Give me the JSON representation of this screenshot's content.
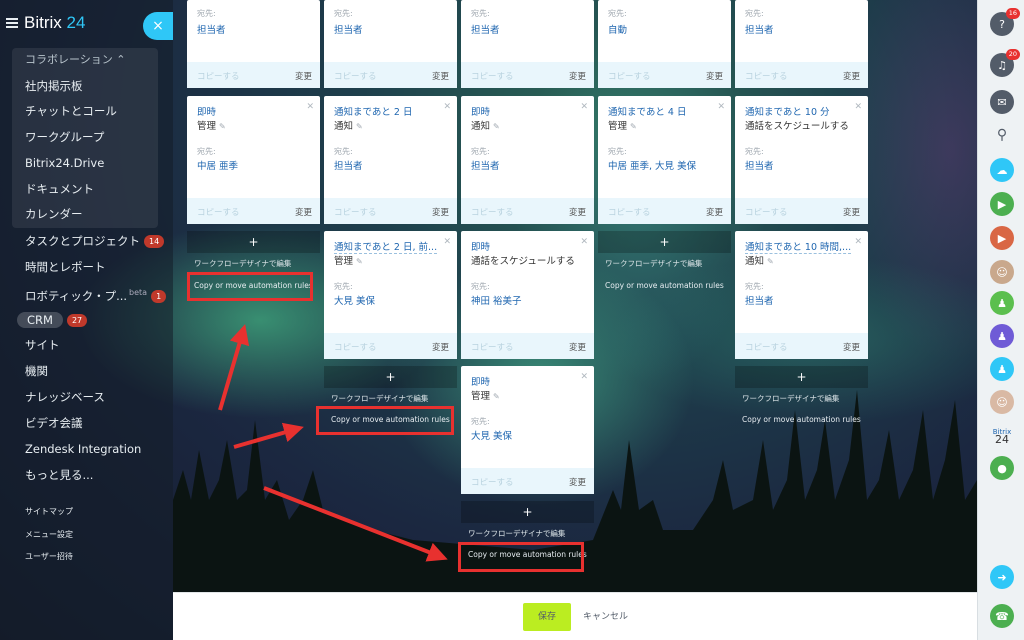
{
  "sidebar": {
    "logo_text": "Bitrix",
    "logo_num": "24",
    "close_symbol": "×",
    "section_label": "コラボレーション ⌃",
    "collab_items": [
      "社内掲示板",
      "チャットとコール",
      "ワークグループ",
      "Bitrix24.Drive",
      "ドキュメント",
      "カレンダー"
    ],
    "tasks_label": "タスクとプロジェクト",
    "tasks_badge": "14",
    "time_label": "時間とレポート",
    "robotic_label": "ロボティック・プ...",
    "robotic_beta": "beta",
    "robotic_badge": "1",
    "crm_label": "CRM",
    "crm_badge": "27",
    "items_after": [
      "サイト",
      "機関",
      "ナレッジベース",
      "ビデオ会議",
      "Zendesk Integration",
      "もっと見る..."
    ],
    "footer_links": [
      "サイトマップ",
      "メニュー設定",
      "ユーザー招待"
    ]
  },
  "common": {
    "recipient_label": "宛先:",
    "copy_label": "コピーする",
    "edit_label": "変更",
    "add_symbol": "+",
    "workflow_label": "ワークフローデザイナで編集",
    "copy_rules_label": "Copy or move automation rules"
  },
  "top_row": [
    {
      "value": "担当者"
    },
    {
      "value": "担当者"
    },
    {
      "value": "担当者"
    },
    {
      "value": "自動"
    },
    {
      "value": "担当者"
    }
  ],
  "row2": [
    {
      "title": "即時",
      "sub": "管理",
      "value": "中居 亜季"
    },
    {
      "title": "通知まであと 2 日",
      "sub": "通知",
      "value": "担当者"
    },
    {
      "title": "即時",
      "sub": "通知",
      "value": "担当者"
    },
    {
      "title": "通知まであと 4 日",
      "sub": "管理",
      "value": "中居 亜季, 大見 美保"
    },
    {
      "title": "通知まであと 10 分",
      "sub": "通話をスケジュールする",
      "value": "担当者"
    }
  ],
  "row3": [
    {
      "title": "通知まであと 2 日, 前...",
      "sub": "管理",
      "value": "大見 美保"
    },
    {
      "title": "即時",
      "sub": "通話をスケジュールする",
      "value": "神田 裕美子"
    },
    {
      "title": "通知まであと 10 時間,...",
      "sub": "通知",
      "value": "担当者"
    }
  ],
  "row4": [
    {
      "title": "即時",
      "sub": "管理",
      "value": "大見 美保"
    }
  ],
  "rightbar": {
    "help_badge": "16",
    "bell_badge": "20",
    "brand_label": "Bitrix",
    "brand_num": "24"
  },
  "bottom": {
    "save_label": "保存",
    "cancel_label": "キャンセル"
  },
  "colors": {
    "accent": "#2fc7f7",
    "link": "#2067b0",
    "highlight": "#e8312f",
    "save": "#bbed21"
  }
}
